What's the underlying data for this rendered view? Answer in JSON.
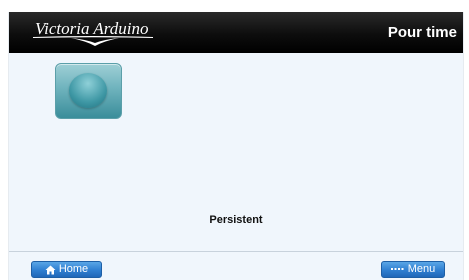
{
  "header": {
    "brand": "Victoria Arduino",
    "title": "Pour time"
  },
  "main": {
    "tile_icon": "circle-icon",
    "status": "Persistent"
  },
  "footer": {
    "home": {
      "label": "Home",
      "icon": "home-icon"
    },
    "menu": {
      "label": "Menu",
      "icon": "dots-icon"
    }
  },
  "colors": {
    "header_bg": "#000000",
    "content_bg": "#f0f6fc",
    "tile": "#4fa2ae",
    "button_blue": "#2f7fd1"
  }
}
